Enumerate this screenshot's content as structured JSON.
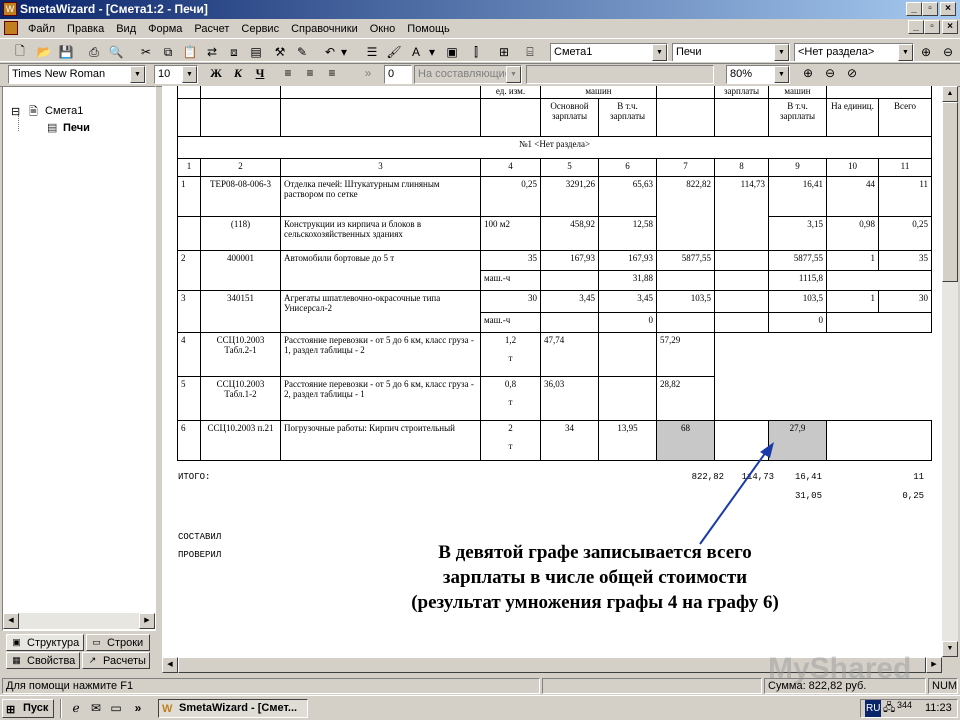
{
  "window": {
    "title": "SmetaWizard - [Смета1:2 - Печи]"
  },
  "menu": [
    "Файл",
    "Правка",
    "Вид",
    "Форма",
    "Расчет",
    "Сервис",
    "Справочники",
    "Окно",
    "Помощь"
  ],
  "toolbar1": {
    "combo_estimate": "Смета1",
    "combo_section": "Печи",
    "combo_part": "<Нет раздела>"
  },
  "toolbar2": {
    "font": "Times New Roman",
    "size": "10",
    "bold": "Ж",
    "italic": "К",
    "underline": "Ч",
    "field_value": "0",
    "component": "На составляющие",
    "zoom": "80%"
  },
  "tree": {
    "root": "Смета1",
    "child": "Печи"
  },
  "panel_tabs": [
    "Структура",
    "Строки",
    "Свойства",
    "Расчеты"
  ],
  "table": {
    "header_top": [
      "ед. изм.",
      "машин",
      "зарплаты",
      "машин"
    ],
    "header_sub": [
      "Основной зарплаты",
      "В т.ч. зарплаты",
      "В т.ч. зарплаты",
      "На единиц.",
      "Всего"
    ],
    "section": "№1 <Нет раздела>",
    "col_numbers": [
      "1",
      "2",
      "3",
      "4",
      "5",
      "6",
      "7",
      "8",
      "9",
      "10",
      "11"
    ],
    "rows": [
      {
        "n": "1",
        "code": "ТЕР08-08-006-3",
        "desc": "Отделка печей: Штукатурным глиняным раствором по сетке",
        "c4": "0,25",
        "c5": "3291,26",
        "c6": "65,63",
        "c7": "822,82",
        "c8": "114,73",
        "c9": "16,41",
        "c10": "44",
        "c11": "11",
        "code2": "(118)",
        "desc2": "Конструкции из кирпича и блоков в сельскохозяйственных зданиях",
        "c4b": "100 м2",
        "c5b": "458,92",
        "c6b": "12,58",
        "c9b": "3,15",
        "c10b": "0,98",
        "c11b": "0,25"
      },
      {
        "n": "2",
        "code": "400001",
        "desc": "Автомобили бортовые до 5 т",
        "c4": "35",
        "c5": "167,93",
        "c6": "167,93",
        "c7": "5877,55",
        "c9": "5877,55",
        "c10": "1",
        "c11": "35",
        "c4b": "маш.-ч",
        "c6b": "31,88",
        "c9b": "1115,8"
      },
      {
        "n": "3",
        "code": "340151",
        "desc": "Агрегаты шпатлевочно-окрасочные типа Унисерсал-2",
        "c4": "30",
        "c5": "3,45",
        "c6": "3,45",
        "c7": "103,5",
        "c9": "103,5",
        "c10": "1",
        "c11": "30",
        "c4b": "маш.-ч",
        "c6b": "0",
        "c9b": "0"
      },
      {
        "n": "4",
        "code": "ССЦ10.2003 Табл.2-1",
        "desc": "Расстояние перевозки - от 5 до 6 км, класс груза - 1, раздел таблицы - 2",
        "c4": "1,2",
        "c4b": "т",
        "c5": "47,74",
        "c7": "57,29"
      },
      {
        "n": "5",
        "code": "ССЦ10.2003 Табл.1-2",
        "desc": "Расстояние перевозки - от 5 до 6 км, класс груза - 2, раздел таблицы - 1",
        "c4": "0,8",
        "c4b": "т",
        "c5": "36,03",
        "c7": "28,82"
      },
      {
        "n": "6",
        "code": "ССЦ10.2003 п.21",
        "desc": "Погрузочные работы: Кирпич строительный",
        "c4": "2",
        "c4b": "т",
        "c5": "34",
        "c6": "13,95",
        "c7": "68",
        "c9": "27,9"
      }
    ],
    "total_label": "ИТОГО:",
    "total": {
      "c7": "822,82",
      "c8": "114,73",
      "c9": "16,41",
      "c11": "11",
      "c9b": "31,05",
      "c11b": "0,25"
    },
    "composed": "СОСТАВИЛ",
    "checked": "ПРОВЕРИЛ"
  },
  "caption": [
    "В девятой графе записывается всего",
    "зарплаты в числе общей стоимости",
    "(результат умножения графы 4 на графу 6)"
  ],
  "watermark": "MyShared",
  "status": {
    "help": "Для помощи нажмите F1",
    "sum": "Сумма: 822,82 руб.",
    "num": "NUM"
  },
  "taskbar": {
    "start": "Пуск",
    "task": "SmetaWizard - [Смет...",
    "lang": "RU",
    "counter": "344",
    "time": "11:23"
  },
  "colors": {
    "titlebar": "#0a246a",
    "highlight_cell": "#c8c8c8",
    "arrow": "#1a3aa8"
  }
}
